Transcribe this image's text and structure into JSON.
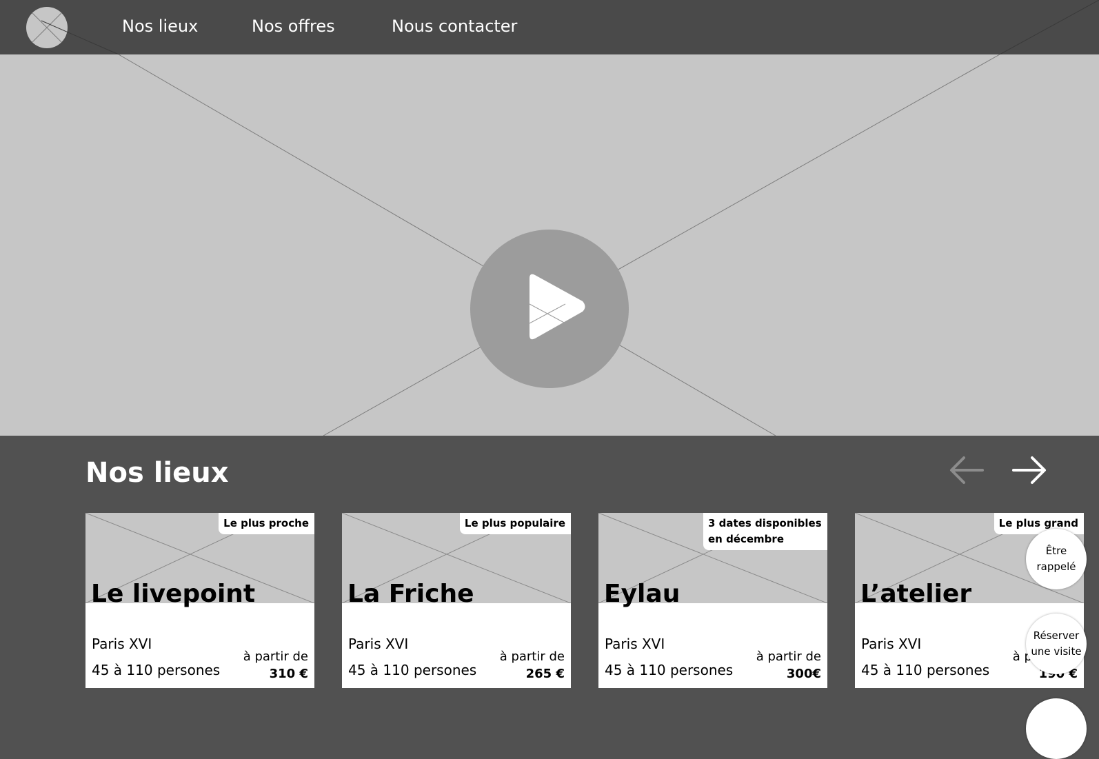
{
  "nav": {
    "logo_icon": "placeholder-image-icon",
    "items": [
      {
        "label": "Nos lieux"
      },
      {
        "label": "Nos offres"
      },
      {
        "label": "Nous contacter"
      }
    ]
  },
  "hero": {
    "type": "video-placeholder",
    "play_icon": "play-icon"
  },
  "section": {
    "title": "Nos lieux",
    "prev_icon": "arrow-left-icon",
    "next_icon": "arrow-right-icon",
    "prev_enabled": false,
    "next_enabled": true
  },
  "venues": [
    {
      "badge": "Le plus proche",
      "name": "Le livepoint",
      "city": "Paris XVI",
      "capacity": "45 à 110 persones",
      "price_prefix": "à partir de",
      "price": "310 €"
    },
    {
      "badge": "Le plus populaire",
      "name": "La Friche",
      "city": "Paris XVI",
      "capacity": "45 à 110 persones",
      "price_prefix": "à partir de",
      "price": "265 €"
    },
    {
      "badge": "3 dates disponibles en décembre",
      "name": "Eylau",
      "city": "Paris XVI",
      "capacity": "45 à 110 persones",
      "price_prefix": "à partir de",
      "price": "300€"
    },
    {
      "badge": "Le plus grand",
      "name": "L’atelier",
      "city": "Paris XVI",
      "capacity": "45 à 110 persones",
      "price_prefix": "à partir de",
      "price": "190 €"
    }
  ],
  "floating_actions": [
    {
      "label": "Être rappelé"
    },
    {
      "label": "Réserver une visite"
    }
  ],
  "colors": {
    "topbar": "#4a4a4a",
    "section_background": "#515151",
    "placeholder": "#c6c6c6",
    "play_button": "#9c9c9c",
    "card_background": "#ffffff",
    "text_light": "#ffffff",
    "text_dark": "#000000"
  }
}
